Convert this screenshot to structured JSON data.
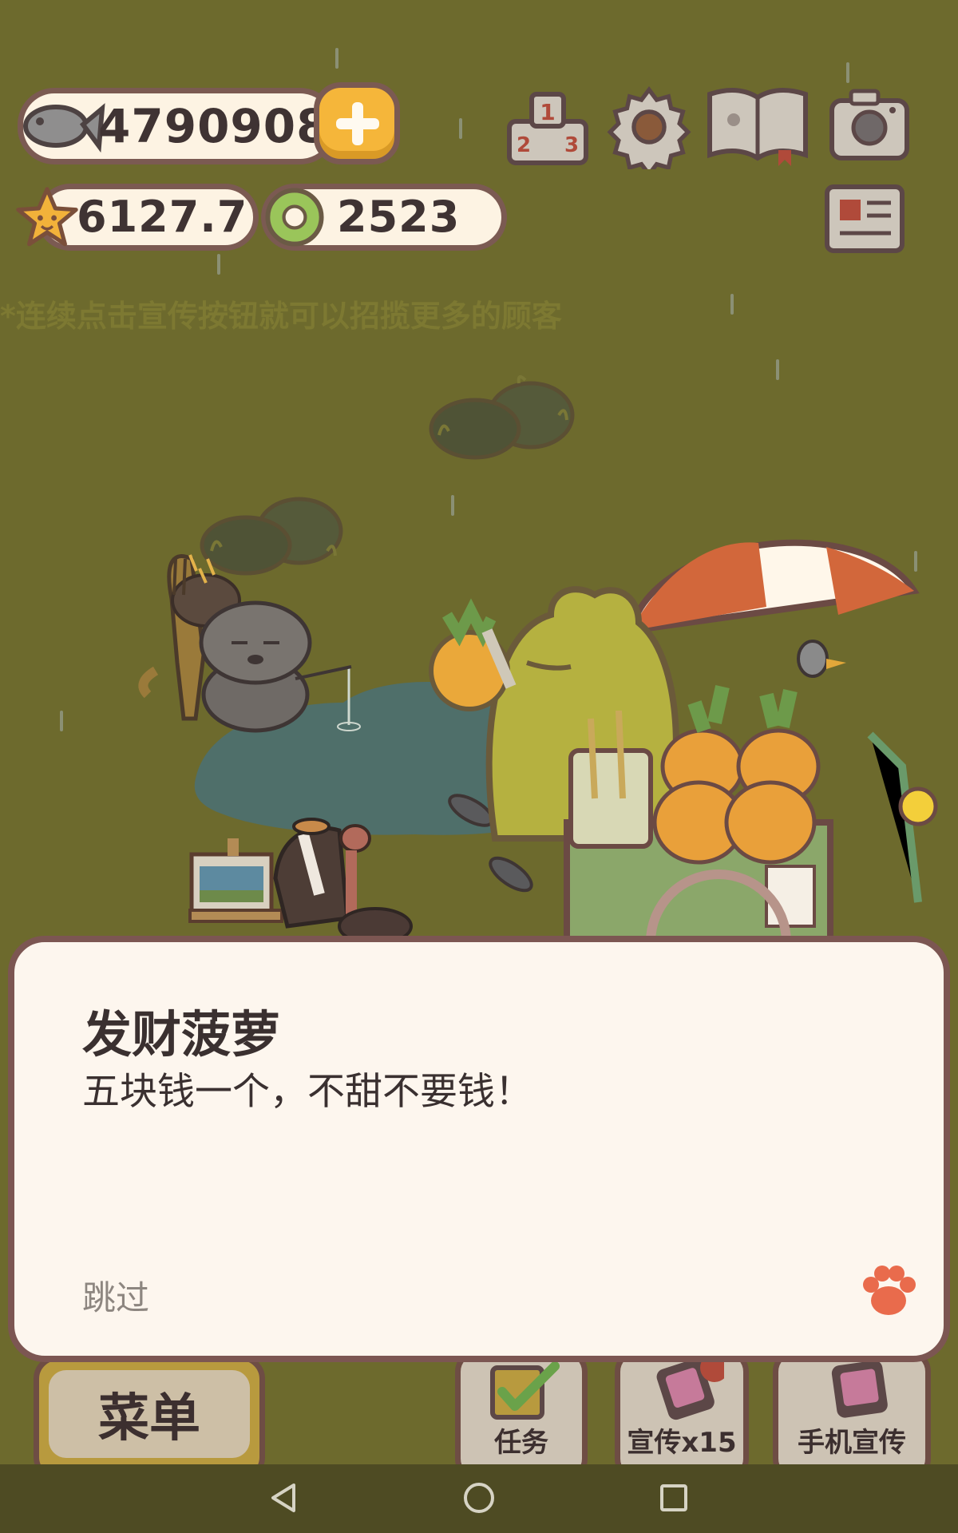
{
  "hud": {
    "fish_count": "4790908",
    "star_rating": "6127.7",
    "ring_count": "2523"
  },
  "tip": {
    "text": "*连续点击宣传按钮就可以招揽更多的顾客"
  },
  "dialog": {
    "title": "发财菠萝",
    "body": "五块钱一个，不甜不要钱！",
    "skip_label": "跳过"
  },
  "bottom_bar": {
    "menu_label": "菜单",
    "task_label": "任务",
    "promote_label": "宣传x15",
    "phone_promote_label": "手机宣传"
  },
  "icons": {
    "fish": "fish-icon",
    "add": "plus-icon",
    "star": "star-icon",
    "ring": "ring-icon",
    "ranking": "podium-icon",
    "settings": "gear-icon",
    "album": "book-icon",
    "camera": "camera-icon",
    "newspaper": "newspaper-icon",
    "paw": "paw-icon",
    "checklist": "checkbox-icon",
    "phone": "phone-icon"
  },
  "colors": {
    "background": "#6d6a2d",
    "accent_yellow": "#f5b63a",
    "outline_brown": "#7b5a52",
    "dialog_bg": "#fdf6ee",
    "paw_orange": "#e96b4c"
  }
}
